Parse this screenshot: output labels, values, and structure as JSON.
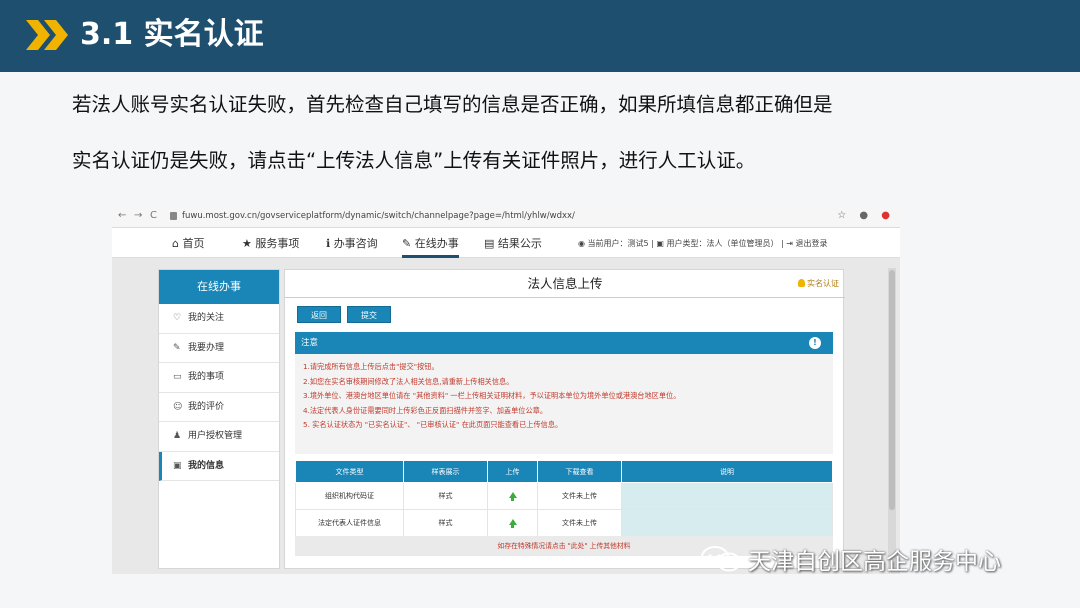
{
  "slide": {
    "title": "3.1 实名认证",
    "para_line1": "若法人账号实名认证失败，首先检查自己填写的信息是否正确，如果所填信息都正确但是",
    "para_line2": "实名认证仍是失败，请点击“上传法人信息”上传有关证件照片，进行人工认证。",
    "header_color": "#1e4f6e",
    "chevron_color": "#f0b400"
  },
  "browser": {
    "url": "fuwu.most.gov.cn/govserviceplatform/dynamic/switch/channelpage?page=/html/yhlw/wdxx/",
    "back": "←",
    "forward": "→",
    "reload": "C",
    "star": "☆",
    "profile": "●",
    "close": "●"
  },
  "site_nav": {
    "items": [
      {
        "icon": "home-icon",
        "glyph": "⌂",
        "label": "首页"
      },
      {
        "icon": "star-icon",
        "glyph": "★",
        "label": "服务事项"
      },
      {
        "icon": "info-icon",
        "glyph": "ℹ",
        "label": "办事咨询"
      },
      {
        "icon": "pencil-icon",
        "glyph": "✎",
        "label": "在线办事"
      },
      {
        "icon": "book-icon",
        "glyph": "▤",
        "label": "结果公示"
      }
    ],
    "user_info": "◉ 当前用户：测试5  |  ▣ 用户类型：法人（单位管理员）  |  ⇥ 退出登录"
  },
  "sidebar": {
    "header": "在线办事",
    "items": [
      {
        "icon": "heart-icon",
        "glyph": "♡",
        "label": "我的关注"
      },
      {
        "icon": "wrench-icon",
        "glyph": "✎",
        "label": "我要办理"
      },
      {
        "icon": "folder-icon",
        "glyph": "▭",
        "label": "我的事项"
      },
      {
        "icon": "smile-icon",
        "glyph": "☺",
        "label": "我的评价"
      },
      {
        "icon": "user-add-icon",
        "glyph": "♟",
        "label": "用户授权管理"
      },
      {
        "icon": "id-card-icon",
        "glyph": "▣",
        "label": "我的信息"
      }
    ]
  },
  "main": {
    "title": "法人信息上传",
    "crumb": "实名认证",
    "back_button": "返回",
    "submit_button": "提交",
    "notice_title": "注意",
    "notice_icon": "!",
    "notice_lines": [
      "1.请完成所有信息上传后点击\"提交\"按钮。",
      "2.如您在实名审核期间修改了法人相关信息,请重新上传相关信息。",
      "3.境外单位、港澳台地区单位请在 \"其他资料\" 一栏上传相关证明材料，予以证明本单位为境外单位或港澳台地区单位。",
      "4.法定代表人身份证需要同时上传彩色正反面扫描件并签字、加盖单位公章。",
      "5. 实名认证状态为 \"已实名认证\"、 \"已审核认证\" 在此页面只能查看已上传信息。"
    ],
    "table": {
      "headers": [
        "文件类型",
        "样表展示",
        "上传",
        "下载查看",
        "说明"
      ],
      "rows": [
        [
          "组织机构代码证",
          "样式",
          "",
          "文件未上传",
          ""
        ],
        [
          "法定代表人证件信息",
          "样式",
          "",
          "文件未上传",
          ""
        ]
      ]
    },
    "footer_note": "如存在特殊情况请点击 \"此处\" 上传其他材料"
  },
  "watermark": {
    "text": "天津自创区高企服务中心"
  }
}
